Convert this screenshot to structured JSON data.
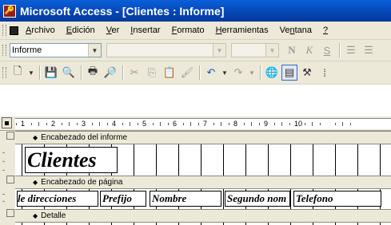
{
  "window": {
    "title": "Microsoft Access - [Clientes : Informe]"
  },
  "menu": {
    "items": [
      {
        "underline": "A",
        "rest": "rchivo"
      },
      {
        "underline": "E",
        "rest": "dición"
      },
      {
        "underline": "V",
        "rest": "er"
      },
      {
        "underline": "I",
        "rest": "nsertar"
      },
      {
        "underline": "F",
        "rest": "ormato"
      },
      {
        "underline": "H",
        "rest": "erramientas"
      },
      {
        "pre": "Ve",
        "underline": "n",
        "rest": "tana"
      },
      {
        "underline": "?",
        "rest": ""
      }
    ]
  },
  "format_toolbar": {
    "object_combo_value": "Informe",
    "font_combo_value": "",
    "size_combo_value": "",
    "bold_label": "N",
    "italic_label": "K",
    "underline_label": "S"
  },
  "ruler": {
    "numbers": [
      "1",
      "2",
      "3",
      "4",
      "5",
      "6",
      "7",
      "8",
      "9",
      "10"
    ]
  },
  "sections": {
    "report_header": "Encabezado del informe",
    "page_header": "Encabezado de página",
    "detail": "Detalle"
  },
  "report_title_label": "Clientes",
  "column_labels": [
    "le direcciones",
    "Prefijo",
    "Nombre",
    "Segundo nom",
    "Telefono"
  ]
}
